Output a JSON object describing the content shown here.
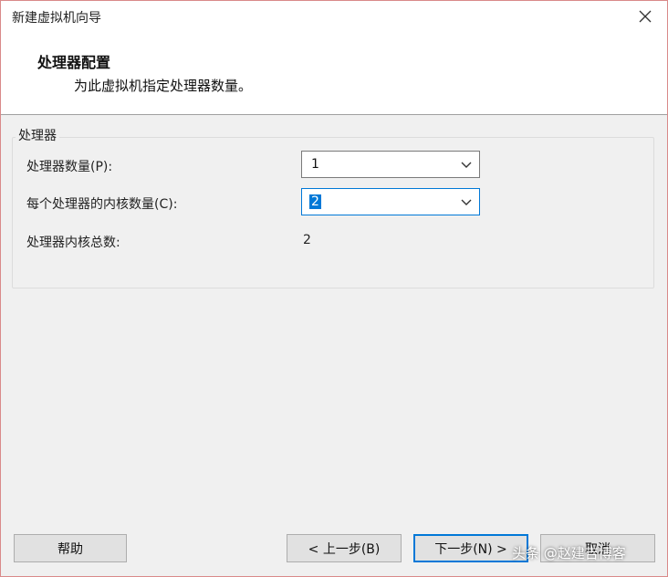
{
  "window": {
    "title": "新建虚拟机向导",
    "close_icon": "close-icon"
  },
  "header": {
    "title": "处理器配置",
    "subtitle": "为此虚拟机指定处理器数量。"
  },
  "processor_group": {
    "legend": "处理器",
    "processor_count_label": "处理器数量(P):",
    "processor_count_value": "1",
    "cores_per_processor_label": "每个处理器的内核数量(C):",
    "cores_per_processor_value": "2",
    "total_cores_label": "处理器内核总数:",
    "total_cores_value": "2"
  },
  "footer": {
    "help_label": "帮助",
    "back_label": "< 上一步(B)",
    "next_label": "下一步(N) >",
    "cancel_label": "取消"
  },
  "watermark": "头条 @赵建吉博客",
  "colors": {
    "accent": "#0078d7",
    "frame_border": "#d98a8a"
  }
}
